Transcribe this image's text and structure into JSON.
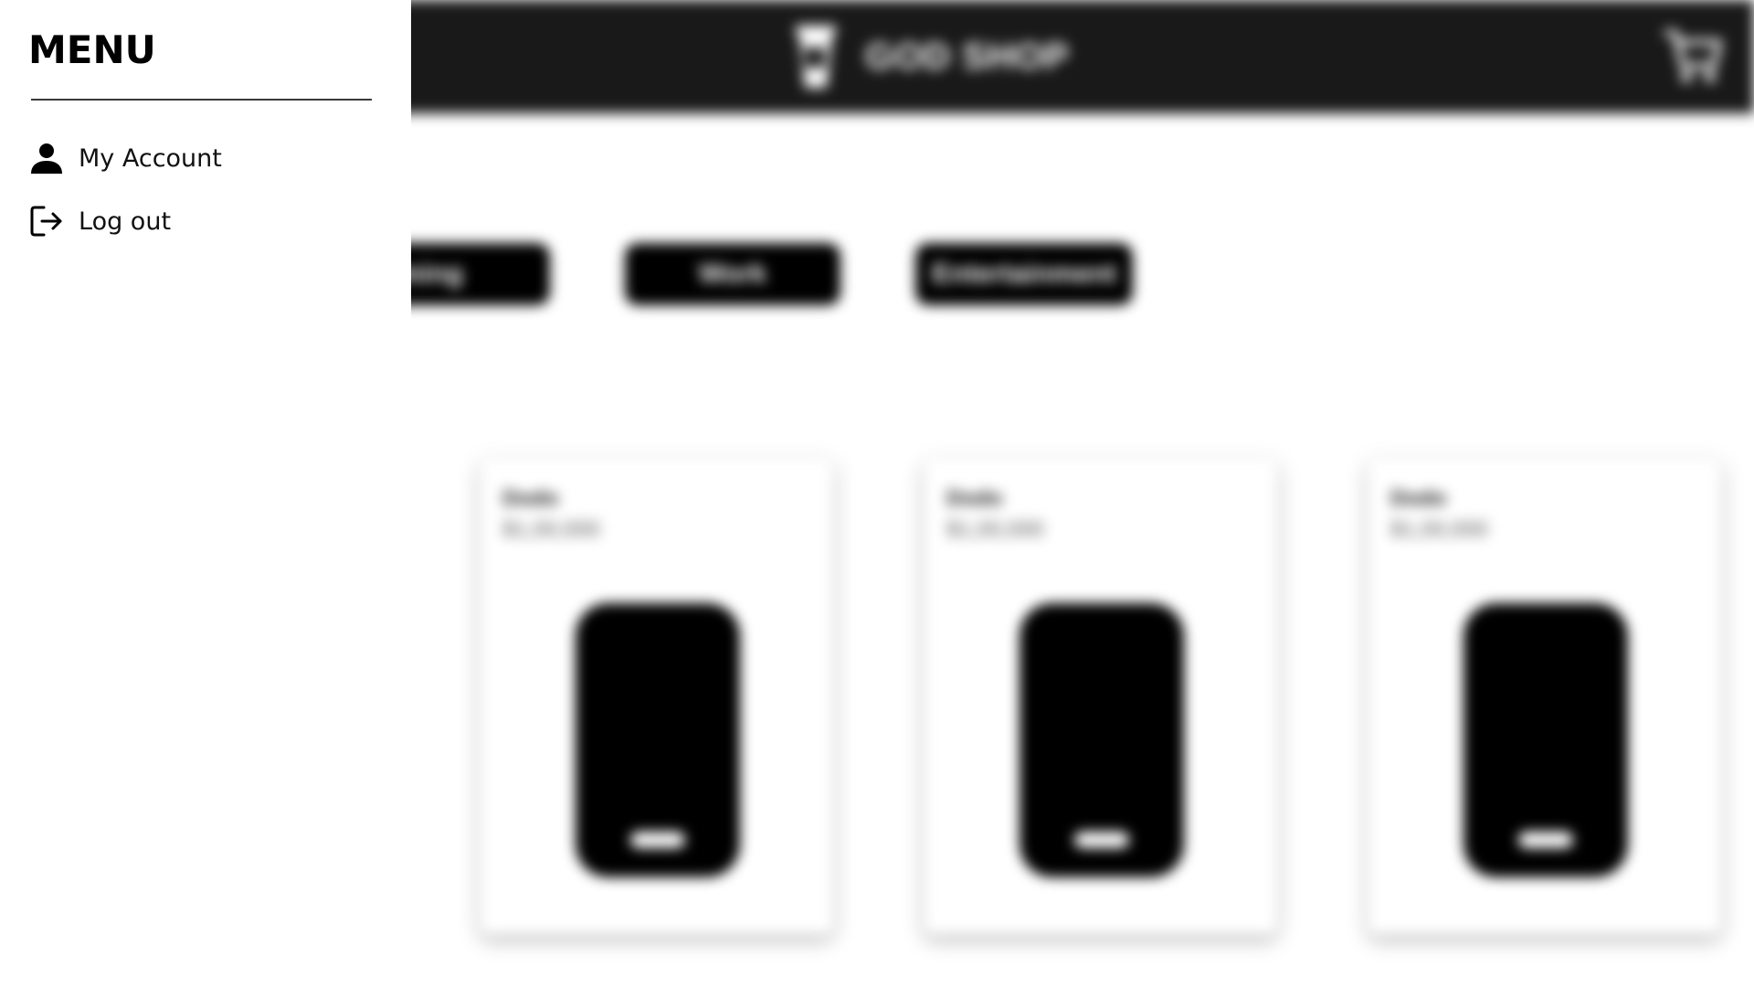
{
  "header": {
    "brand_name": "GOD SHOP",
    "logo_icon": "cup-logo-icon",
    "cart_icon": "cart-icon",
    "background_color": "#191919"
  },
  "categories": [
    {
      "label": "Gaming"
    },
    {
      "label": "Work"
    },
    {
      "label": "Entertainment"
    }
  ],
  "products": [
    {
      "name": "Dodo",
      "price": "$1,00,000",
      "image_icon": "phone-icon"
    },
    {
      "name": "Dodo",
      "price": "$1,00,000",
      "image_icon": "phone-icon"
    },
    {
      "name": "Dodo",
      "price": "$1,00,000",
      "image_icon": "phone-icon"
    }
  ],
  "menu": {
    "title": "MENU",
    "items": [
      {
        "label": "My Account",
        "icon": "person-icon"
      },
      {
        "label": "Log out",
        "icon": "logout-icon"
      }
    ]
  }
}
